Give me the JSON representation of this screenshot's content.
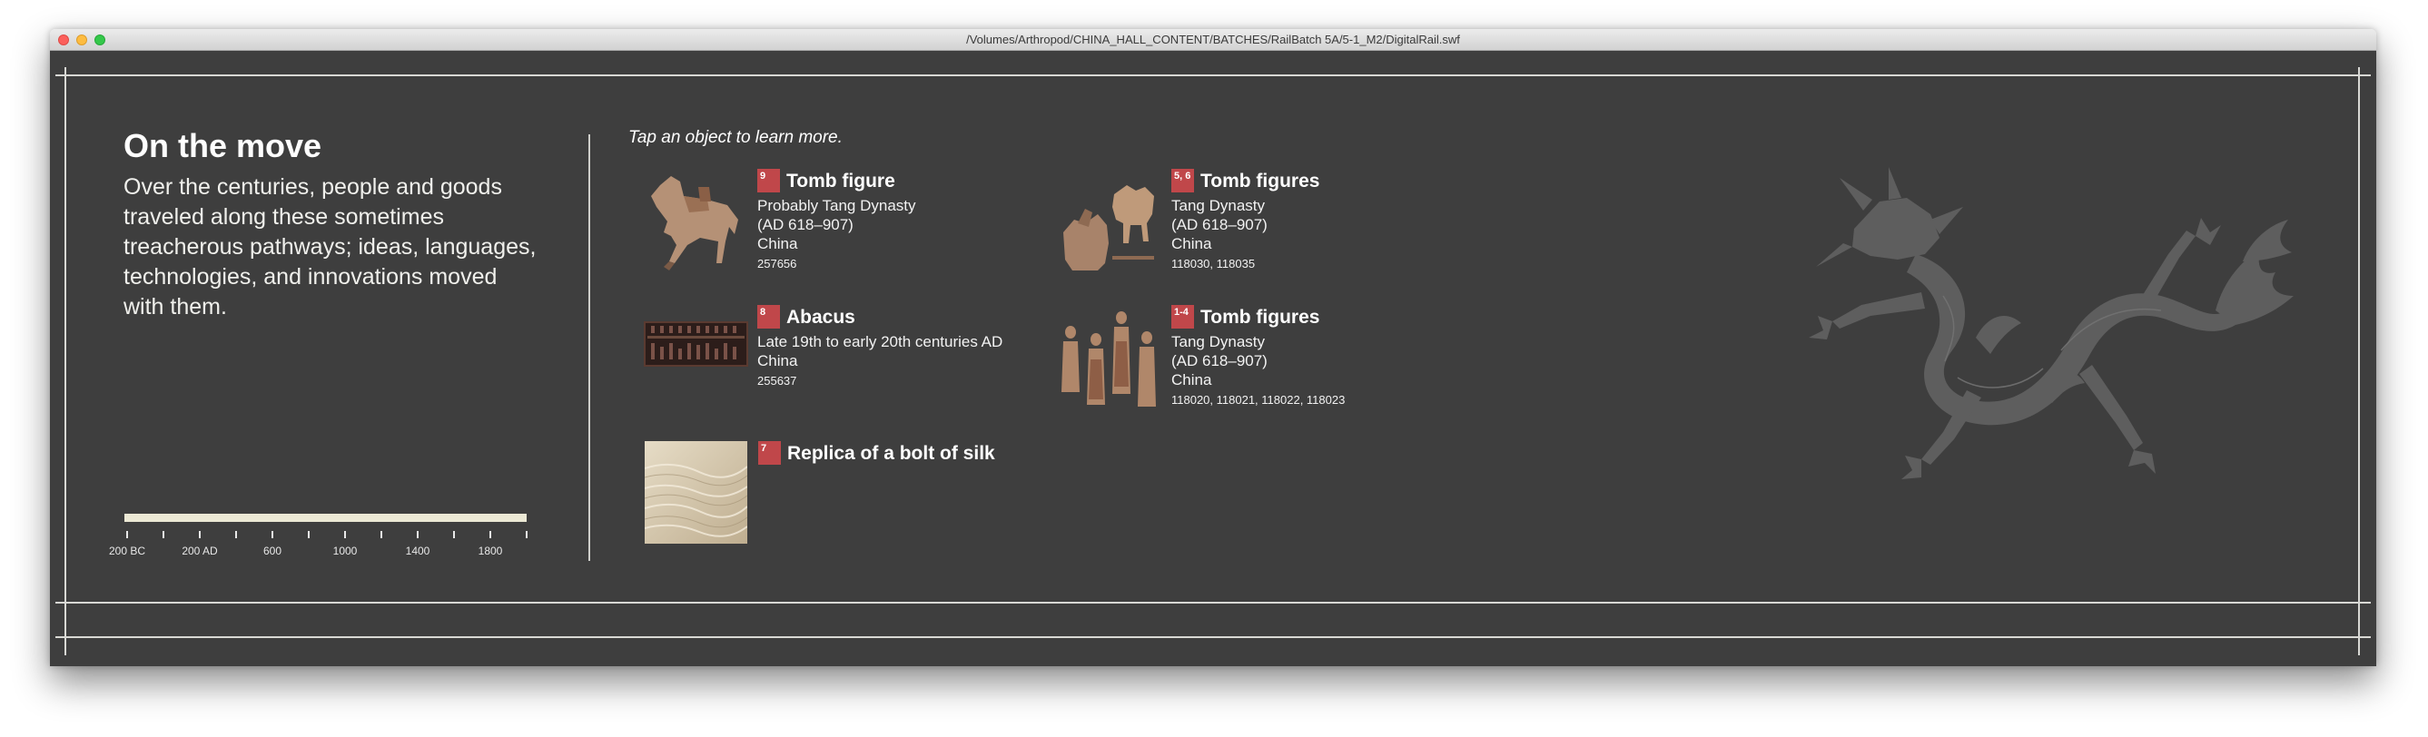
{
  "window": {
    "title": "/Volumes/Arthropod/CHINA_HALL_CONTENT/BATCHES/RailBatch 5A/5-1_M2/DigitalRail.swf"
  },
  "panel": {
    "heading": "On the move",
    "intro": "Over the centuries, people and goods traveled along these sometimes treacherous pathways; ideas, languages, technologies, and innovations moved with them.",
    "hint": "Tap an object to learn more."
  },
  "timeline": {
    "labels": [
      "200 BC",
      "200 AD",
      "600",
      "1000",
      "1400",
      "1800"
    ]
  },
  "objects": [
    {
      "badge": "9",
      "title": "Tomb figure",
      "lines": [
        "Probably Tang Dynasty",
        "(AD 618–907)",
        "China"
      ],
      "catalog": "257656",
      "thumb_icon": "horse-figure-image"
    },
    {
      "badge": "5, 6",
      "title": "Tomb figures",
      "lines": [
        "Tang Dynasty",
        "(AD 618–907)",
        "China"
      ],
      "catalog": "118030, 118035",
      "thumb_icon": "camel-figures-image"
    },
    {
      "badge": "8",
      "title": "Abacus",
      "lines": [
        "Late 19th to early 20th centuries AD",
        "China"
      ],
      "catalog": "255637",
      "thumb_icon": "abacus-image"
    },
    {
      "badge": "1-4",
      "title": "Tomb figures",
      "lines": [
        "Tang Dynasty",
        "(AD 618–907)",
        "China"
      ],
      "catalog": "118020, 118021, 118022, 118023",
      "thumb_icon": "standing-figures-image"
    },
    {
      "badge": "7",
      "title": "Replica of a bolt of silk",
      "lines": [],
      "catalog": "",
      "thumb_icon": "silk-bolt-image"
    }
  ],
  "decor": {
    "dragon_icon": "dragon-silhouette",
    "background_color": "#3e3e3e",
    "badge_color": "#c0474a"
  }
}
